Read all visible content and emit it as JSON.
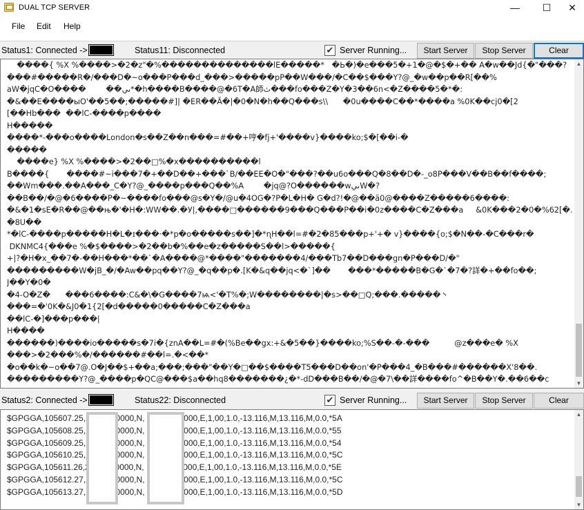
{
  "window": {
    "title": "DUAL TCP SERVER",
    "minimize_glyph": "—",
    "maximize_glyph": "☐",
    "close_glyph": "✕"
  },
  "menu": [
    "File",
    "Edit",
    "Help"
  ],
  "panel1": {
    "status1": "Status1: Connected ->",
    "status11": "Status11: Disconnected",
    "server_running_label": "Server Running...",
    "server_running_checked": true,
    "start_label": "Start Server",
    "stop_label": "Stop Server",
    "clear_label": "Clear",
    "lines": [
      "    ����{ %X %����>�2�z\"�%��������������lE�����*   �Ь�)�e���5�+1�@�$�+�� A�w��Jd{�\"���?",
      "���#�����R�/���D�~o���P���d_���>�����pP��W���/�C��$���Y?@_�w��p��R[��%",
      "aW�jqC�O����        ��ىي*�h����B����@�6T�A師ث���fo���Z�Y�3��6n<�Z����5�*�:",
      "�&��E����ыO'��5��;�����#]| �ER��Ã�|�0�N�h��Q���s\\\\      �0u����C��*����a %0K��cj0�[2",
      "[��Hb���  ��lC-����p����",
      "H�����",
      "����*-���o����London�s��Z��n���=#��+哼�fj+'����v}����ko;$�[��i-�",
      "�����",
      "    ����e} %X %����>�2��□%�x����������l",
      "B����{       ����#~i���7�+��D��+���`B/��EE�O�\"���?��u6o���Q�8��D�-_o8P���V��B��f����;",
      "��Wm���.��A���_C�Y?@_����p���Q��%A        �jq@?O������wىيW�?",
      "��B��/�@�6����P�~����fo���@s�Y�/@u�4OG�?P�L�H� G�d?!�@��ä0@����Z�����6����:",
      "�&�1�sE�R��@��њ�'�H�:WW��.�У|,����□������9���Q���P��i�0z����C�Z���a     &0K���2�0�%62[�.",
      "�8U��",
      "*�lC-����p�����H�L�ɪ���·�*p�o�����s��]�*ɳH��l=#�2�85���p+'+� v}����{o;$�N��-�C���r�",
      " DKNMC4{���e %�$����>�2��b�%��e�z�����S��l>�����{",
      "+|?�H�x_��7�-��H���*��`�A����@*����\"�������4/���Tb7��D���gn�P���D/�\"",
      "���������W�jB_�/�Aw��pq��Y?@_�q��p�.[K�&q��jq<�`]��       ���*�����B�G�`�7�?詳�+��fo��;",
      "J��Y�0�",
      "�4-O�Z�      ���6����:C&�\\�G����7ѩ<'�T%�;W��������|�s>��□Q;���.�����丶",
      "���=�'0K�&J0�1{2[�d�����0�����C�Z���a",
      "��lC-�]���p���|",
      "H����",
      "������)����io�����s�7i�{znA��L=#�(%Be��gx:+&�5��}����ko;%S��-�-���          @z���e� %X",
      "���>�2���%�/������#��l=.�<��*",
      "�o��k�~o��7@.O�J��$+��a;���;���\"��Y�□��$����T5���D��on'�P���4_�B���#������X'8��.",
      "���������Y?@_����p�QC@���$a��hq8�������¿�*-dD���B��/�@�7\\��詳����fo^�B��Y�.��6��c"
    ]
  },
  "panel2": {
    "status2": "Status2: Connected ->",
    "status22": "Status22: Disconnected",
    "server_running_label": "Server Running...",
    "server_running_checked": true,
    "start_label": "Start Server",
    "stop_label": "Stop Server",
    "clear_label": "Clear",
    "lines": [
      "$GPGGA,105607.25,2           0000,N,             20000,E,1,00,1.0,-13.116,M,13.116,M,0.0,*5A",
      "$GPGGA,105608.25,2           0000,N,             20000,E,1,00,1.0,-13.116,M,13.116,M,0.0,*55",
      "$GPGGA,105609.25,2           0000,N,             20000,E,1,00,1.0,-13.116,M,13.116,M,0.0,*54",
      "$GPGGA,105610.25,2           0000,N,             20000,E,1,00,1.0,-13.116,M,13.116,M,0.0,*5C",
      "$GPGGA,105611.26,2           0000,N,             20000,E,1,00,1.0,-13.116,M,13.116,M,0.0,*5E",
      "$GPGGA,105612.27,2           0000,N,             20000,E,1,00,1.0,-13.116,M,13.116,M,0.0,*5C",
      "$GPGGA,105613.27,2           0000,N,             20000,E,1,00,1.0,-13.116,M,13.116,M,0.0,*5D"
    ]
  }
}
